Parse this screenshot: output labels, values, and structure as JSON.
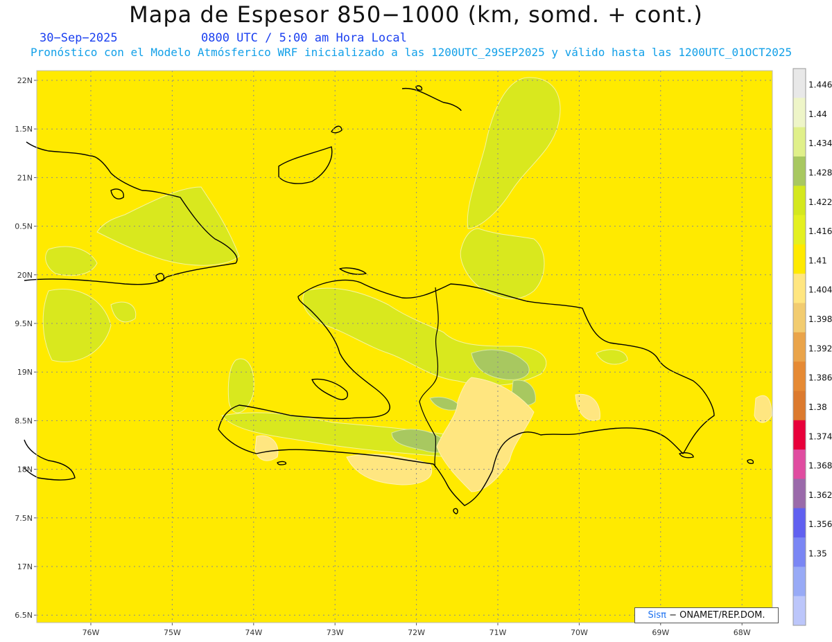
{
  "header": {
    "title": "Mapa de Espesor 850−1000 (km, somd. + cont.)",
    "date": "30−Sep−2025",
    "time": "0800 UTC / 5:00 am Hora Local",
    "subtitle": "Pronóstico con el Modelo Atmósferico WRF inicializado a las 1200UTC_29SEP2025 y válido hasta las  1200UTC_01OCT2025"
  },
  "map": {
    "lon_labels": [
      "76W",
      "75W",
      "74W",
      "73W",
      "72W",
      "71W",
      "70W",
      "69W",
      "68W"
    ],
    "lat_labels": [
      "22N",
      "1.5N",
      "21N",
      "0.5N",
      "20N",
      "9.5N",
      "19N",
      "8.5N",
      "18N",
      "7.5N",
      "17N",
      "6.5N"
    ],
    "background_value_color": "#ffea00"
  },
  "colorbar": {
    "labels": [
      "1.446",
      "1.44",
      "1.434",
      "1.428",
      "1.422",
      "1.416",
      "1.41",
      "1.404",
      "1.398",
      "1.392",
      "1.386",
      "1.38",
      "1.374",
      "1.368",
      "1.362",
      "1.356",
      "1.35"
    ],
    "colors": [
      "#e8e8e8",
      "#eef5c8",
      "#e0f08a",
      "#a8c860",
      "#d4e81e",
      "#e4f020",
      "#ffea00",
      "#ffe680",
      "#f2cc70",
      "#eaa44a",
      "#e68a34",
      "#dc7a2e",
      "#e8003a",
      "#e04ca0",
      "#9a6aaa",
      "#6060f0",
      "#7a86f4",
      "#98aaf6",
      "#bcc6fa"
    ]
  },
  "credit": {
    "brand": "Sisπ",
    "text": "− ONAMET/REP.DOM."
  }
}
